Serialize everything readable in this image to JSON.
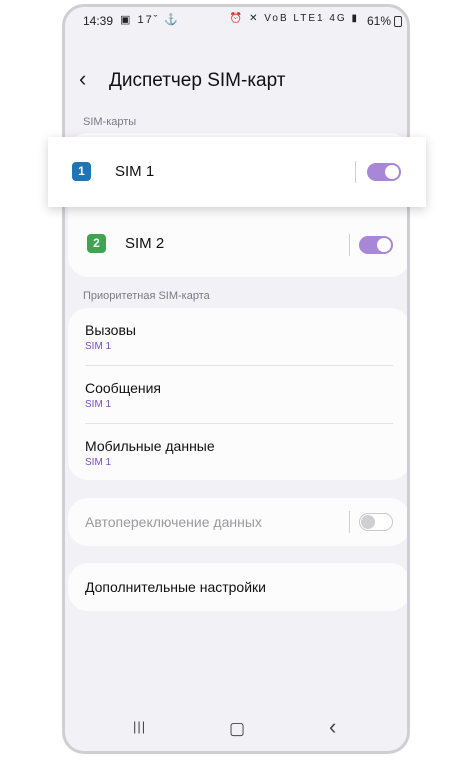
{
  "status_bar": {
    "time": "14:39",
    "left_icons": "▣ 17ˇ ⚓",
    "right_icons": "⏰ ✕ VoB LTE1 4G ▮",
    "battery": "61%"
  },
  "header": {
    "title": "Диспетчер SIM-карт",
    "back_icon": "chevron-left-icon"
  },
  "sim_section": {
    "label": "SIM-карты",
    "sims": [
      {
        "badge": "1",
        "name": "SIM 1",
        "enabled": true,
        "color": "#1f74b5"
      },
      {
        "badge": "2",
        "name": "SIM 2",
        "enabled": true,
        "color": "#3fa352"
      }
    ]
  },
  "priority_section": {
    "label": "Приоритетная SIM-карта",
    "items": [
      {
        "title": "Вызовы",
        "value": "SIM 1"
      },
      {
        "title": "Сообщения",
        "value": "SIM 1"
      },
      {
        "title": "Мобильные данные",
        "value": "SIM 1"
      }
    ]
  },
  "auto_switch": {
    "label": "Автопереключение данных",
    "enabled": false
  },
  "more_settings": {
    "label": "Дополнительные настройки"
  },
  "navbar": {
    "recent": "|||",
    "home": "▢",
    "back": "‹"
  },
  "colors": {
    "accent": "#a887d6",
    "sub_text": "#7b4cc2",
    "background": "#f2f1f6"
  }
}
